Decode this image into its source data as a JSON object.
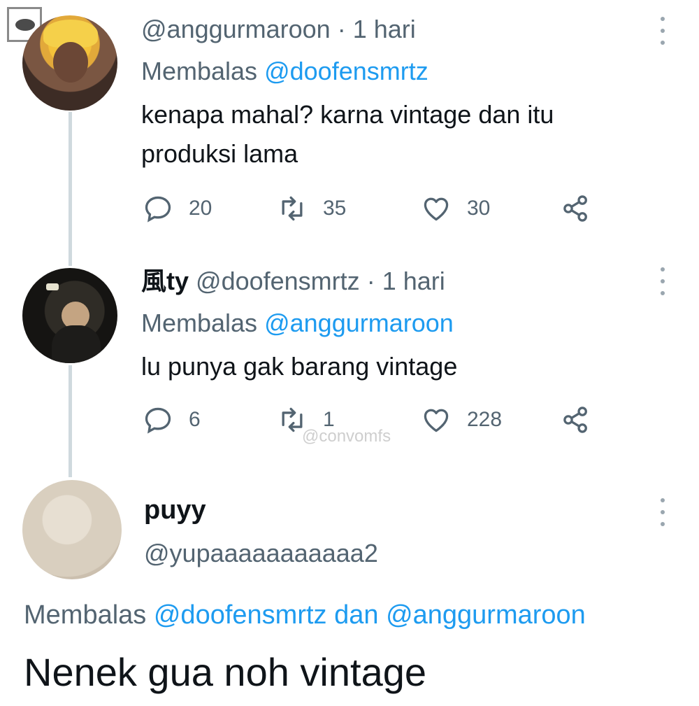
{
  "tweets": [
    {
      "display_name": "",
      "handle": "@anggurmaroon",
      "time": "1 hari",
      "reply_prefix": "Membalas",
      "reply_to": "@doofensmrtz",
      "text": "kenapa mahal? karna vintage dan itu produksi lama",
      "replies": "20",
      "retweets": "35",
      "likes": "30"
    },
    {
      "display_name": "風ty",
      "handle": "@doofensmrtz",
      "time": "1 hari",
      "reply_prefix": "Membalas",
      "reply_to": "@anggurmaroon",
      "text": "lu punya gak barang vintage",
      "replies": "6",
      "retweets": "1",
      "likes": "228"
    }
  ],
  "main_tweet": {
    "display_name": "puyy",
    "handle": "@yupaaaaaaaaaaa2",
    "reply_prefix": "Membalas",
    "reply_to_1": "@doofensmrtz",
    "reply_joiner": "dan",
    "reply_to_2": "@anggurmaroon",
    "text": "Nenek gua noh vintage"
  },
  "watermark": "@convomfs",
  "separator": "·",
  "icons": {
    "reply": "reply-icon",
    "retweet": "retweet-icon",
    "like": "heart-icon",
    "share": "share-icon",
    "more": "more-options-icon"
  },
  "colors": {
    "link": "#1d9bf0",
    "muted": "#536471",
    "text": "#0f1419",
    "thread_line": "#cfd9de"
  }
}
